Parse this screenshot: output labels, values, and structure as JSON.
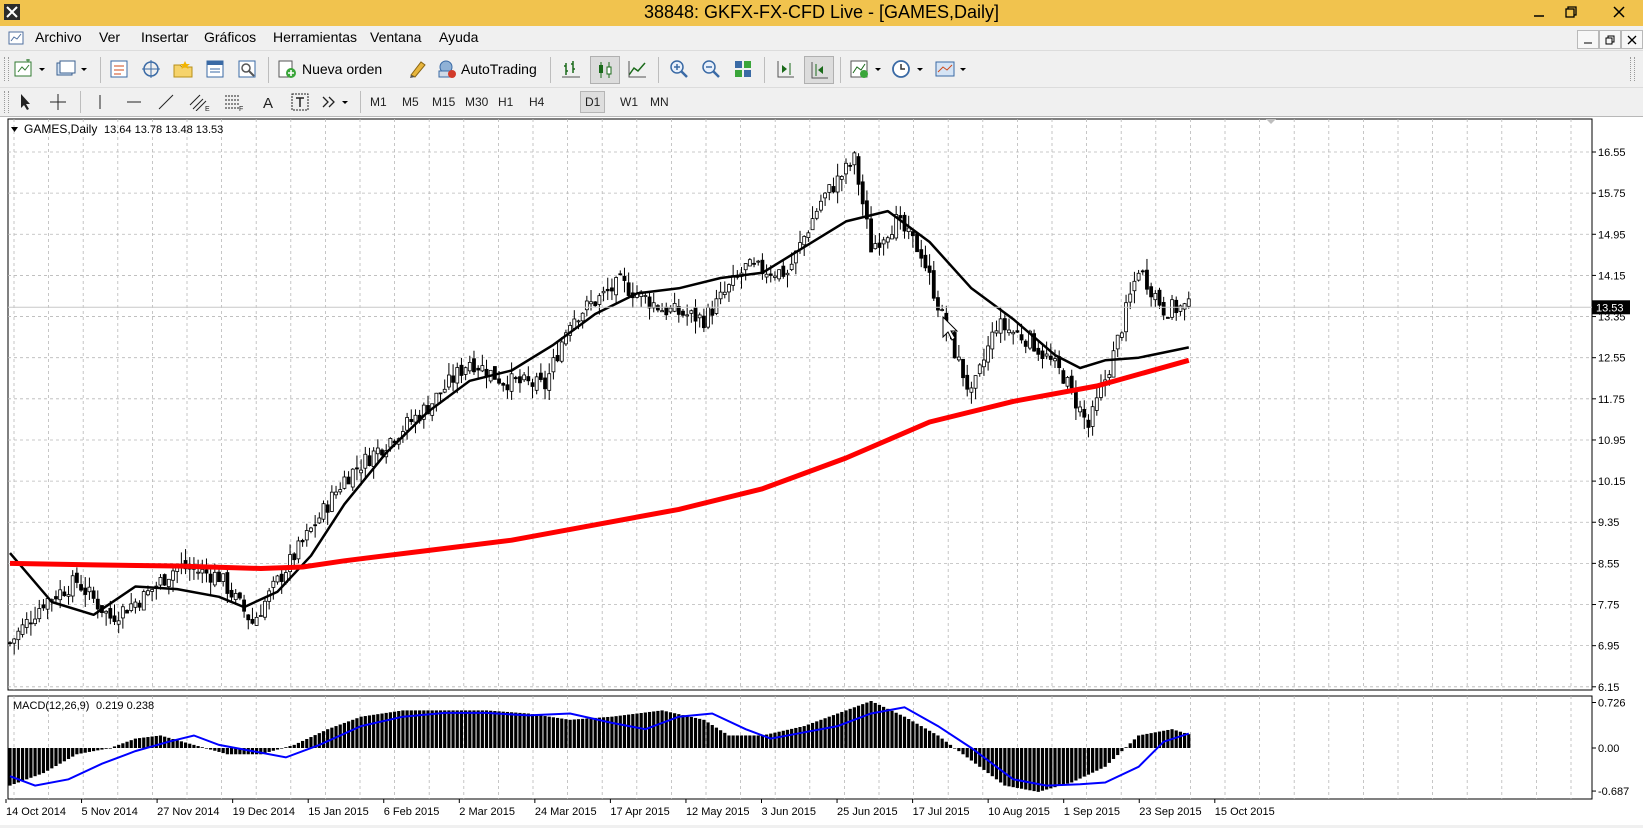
{
  "window": {
    "title": "38848: GKFX-FX-CFD Live - [GAMES,Daily]"
  },
  "menu": [
    "Archivo",
    "Ver",
    "Insertar",
    "Gráficos",
    "Herramientas",
    "Ventana",
    "Ayuda"
  ],
  "toolbar": {
    "new_order": "Nueva orden",
    "autotrading": "AutoTrading",
    "search_placeholder": ""
  },
  "periods": [
    "M1",
    "M5",
    "M15",
    "M30",
    "H1",
    "H4",
    "D1",
    "W1",
    "MN"
  ],
  "active_period": "D1",
  "chart_data": [
    {
      "type": "candlestick",
      "title": "GAMES,Daily",
      "ohlc_text": "13.64 13.78 13.48 13.53",
      "last_price": "13.53",
      "y_ticks": [
        "16.55",
        "15.75",
        "14.95",
        "14.15",
        "13.35",
        "12.55",
        "11.75",
        "10.95",
        "10.15",
        "9.35",
        "8.55",
        "7.75",
        "6.95",
        "6.15"
      ],
      "ylim": [
        6.15,
        16.95
      ],
      "x_ticks": [
        "14 Oct 2014",
        "5 Nov 2014",
        "27 Nov 2014",
        "19 Dec 2014",
        "15 Jan 2015",
        "6 Feb 2015",
        "2 Mar 2015",
        "24 Mar 2015",
        "17 Apr 2015",
        "12 May 2015",
        "3 Jun 2015",
        "25 Jun 2015",
        "17 Jul 2015",
        "10 Aug 2015",
        "1 Sep 2015",
        "23 Sep 2015",
        "15 Oct 2015"
      ],
      "close_path": [
        [
          0,
          7.0
        ],
        [
          8,
          7.8
        ],
        [
          16,
          8.2
        ],
        [
          24,
          7.5
        ],
        [
          32,
          7.9
        ],
        [
          40,
          8.5
        ],
        [
          50,
          8.3
        ],
        [
          58,
          7.4
        ],
        [
          64,
          8.2
        ],
        [
          72,
          9.2
        ],
        [
          80,
          10.2
        ],
        [
          90,
          10.9
        ],
        [
          100,
          11.6
        ],
        [
          110,
          12.5
        ],
        [
          118,
          12.1
        ],
        [
          128,
          12.0
        ],
        [
          134,
          13.3
        ],
        [
          146,
          14.0
        ],
        [
          156,
          13.5
        ],
        [
          166,
          13.3
        ],
        [
          176,
          14.3
        ],
        [
          186,
          14.2
        ],
        [
          194,
          15.6
        ],
        [
          202,
          16.4
        ],
        [
          206,
          14.7
        ],
        [
          212,
          15.2
        ],
        [
          218,
          14.6
        ],
        [
          224,
          13.1
        ],
        [
          230,
          11.8
        ],
        [
          236,
          13.2
        ],
        [
          244,
          12.9
        ],
        [
          252,
          12.2
        ],
        [
          258,
          11.2
        ],
        [
          264,
          12.6
        ],
        [
          270,
          14.3
        ],
        [
          276,
          13.5
        ],
        [
          282,
          13.53
        ]
      ],
      "series": [
        {
          "name": "",
          "color": "#000000",
          "points": [
            [
              0,
              8.75
            ],
            [
              10,
              7.8
            ],
            [
              20,
              7.55
            ],
            [
              30,
              8.1
            ],
            [
              40,
              8.05
            ],
            [
              50,
              7.9
            ],
            [
              56,
              7.7
            ],
            [
              64,
              8.0
            ],
            [
              72,
              8.7
            ],
            [
              80,
              9.7
            ],
            [
              90,
              10.7
            ],
            [
              100,
              11.5
            ],
            [
              110,
              12.1
            ],
            [
              120,
              12.3
            ],
            [
              130,
              12.8
            ],
            [
              140,
              13.4
            ],
            [
              150,
              13.8
            ],
            [
              160,
              13.9
            ],
            [
              170,
              14.1
            ],
            [
              180,
              14.2
            ],
            [
              190,
              14.7
            ],
            [
              200,
              15.2
            ],
            [
              210,
              15.4
            ],
            [
              220,
              14.8
            ],
            [
              230,
              13.9
            ],
            [
              240,
              13.3
            ],
            [
              250,
              12.6
            ],
            [
              256,
              12.35
            ],
            [
              262,
              12.5
            ],
            [
              270,
              12.55
            ],
            [
              282,
              12.75
            ]
          ]
        },
        {
          "name": "",
          "color": "#ff0000",
          "points": [
            [
              0,
              8.55
            ],
            [
              20,
              8.52
            ],
            [
              40,
              8.5
            ],
            [
              60,
              8.45
            ],
            [
              70,
              8.48
            ],
            [
              80,
              8.6
            ],
            [
              100,
              8.8
            ],
            [
              120,
              9.0
            ],
            [
              140,
              9.3
            ],
            [
              160,
              9.6
            ],
            [
              180,
              10.0
            ],
            [
              200,
              10.6
            ],
            [
              220,
              11.3
            ],
            [
              240,
              11.7
            ],
            [
              260,
              12.0
            ],
            [
              282,
              12.5
            ]
          ]
        }
      ]
    },
    {
      "type": "bar",
      "title": "MACD(12,26,9)",
      "values_text": "0.219 0.238",
      "y_ticks": [
        "0.726",
        "0.00",
        "-0.687"
      ],
      "ylim": [
        -0.72,
        0.77
      ],
      "histogram_path": [
        [
          0,
          -0.6
        ],
        [
          8,
          -0.4
        ],
        [
          16,
          -0.1
        ],
        [
          24,
          0.0
        ],
        [
          30,
          0.15
        ],
        [
          36,
          0.2
        ],
        [
          44,
          0.05
        ],
        [
          52,
          -0.1
        ],
        [
          60,
          -0.1
        ],
        [
          68,
          0.05
        ],
        [
          76,
          0.3
        ],
        [
          84,
          0.5
        ],
        [
          94,
          0.6
        ],
        [
          104,
          0.6
        ],
        [
          114,
          0.6
        ],
        [
          124,
          0.55
        ],
        [
          134,
          0.45
        ],
        [
          144,
          0.5
        ],
        [
          156,
          0.6
        ],
        [
          166,
          0.45
        ],
        [
          172,
          0.2
        ],
        [
          180,
          0.2
        ],
        [
          190,
          0.35
        ],
        [
          198,
          0.55
        ],
        [
          206,
          0.75
        ],
        [
          214,
          0.5
        ],
        [
          222,
          0.2
        ],
        [
          230,
          -0.2
        ],
        [
          238,
          -0.6
        ],
        [
          246,
          -0.7
        ],
        [
          254,
          -0.55
        ],
        [
          262,
          -0.3
        ],
        [
          270,
          0.2
        ],
        [
          278,
          0.3
        ],
        [
          282,
          0.22
        ]
      ],
      "series": [
        {
          "name": "",
          "color": "#0000ff",
          "points": [
            [
              0,
              -0.45
            ],
            [
              6,
              -0.6
            ],
            [
              14,
              -0.5
            ],
            [
              22,
              -0.25
            ],
            [
              30,
              -0.05
            ],
            [
              38,
              0.1
            ],
            [
              44,
              0.2
            ],
            [
              50,
              0.05
            ],
            [
              58,
              -0.05
            ],
            [
              66,
              -0.15
            ],
            [
              74,
              0.05
            ],
            [
              84,
              0.35
            ],
            [
              94,
              0.5
            ],
            [
              104,
              0.56
            ],
            [
              114,
              0.56
            ],
            [
              124,
              0.52
            ],
            [
              134,
              0.55
            ],
            [
              144,
              0.4
            ],
            [
              152,
              0.3
            ],
            [
              160,
              0.5
            ],
            [
              168,
              0.55
            ],
            [
              176,
              0.3
            ],
            [
              182,
              0.15
            ],
            [
              190,
              0.25
            ],
            [
              198,
              0.35
            ],
            [
              206,
              0.55
            ],
            [
              214,
              0.65
            ],
            [
              222,
              0.35
            ],
            [
              230,
              0.0
            ],
            [
              240,
              -0.5
            ],
            [
              248,
              -0.6
            ],
            [
              256,
              -0.58
            ],
            [
              262,
              -0.55
            ],
            [
              270,
              -0.3
            ],
            [
              276,
              0.1
            ],
            [
              282,
              0.23
            ]
          ]
        }
      ]
    }
  ]
}
